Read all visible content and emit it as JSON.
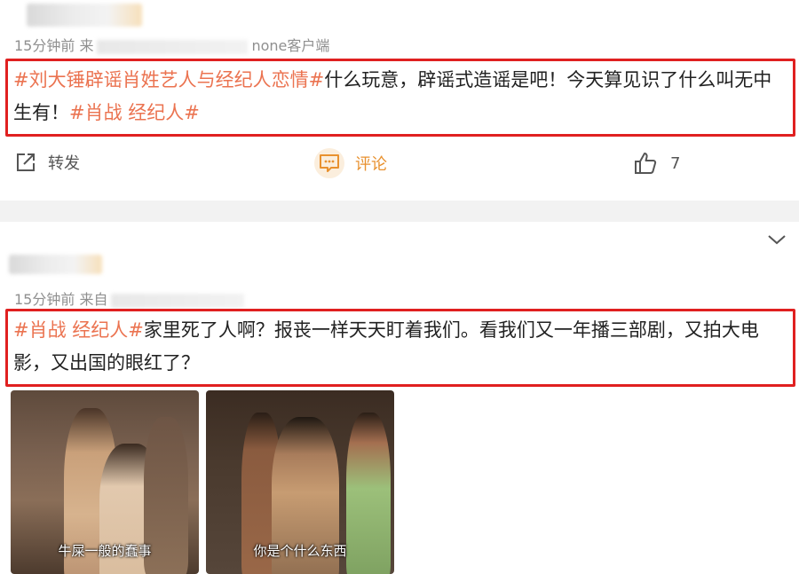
{
  "post1": {
    "meta_time": "15分钟前",
    "meta_source_prefix": "来",
    "meta_source_suffix": "none客户端",
    "content_tag": "#刘大锤辟谣肖姓艺人与经纪人恋情#",
    "content_text1": "什么玩意，辟谣式造谣是吧！今天算见识了什么叫无中生有！",
    "content_tag2": "#肖战 经纪人#",
    "actions": {
      "repost_label": "转发",
      "comment_label": "评论",
      "like_count": "7"
    }
  },
  "post2": {
    "meta_time": "15分钟前",
    "meta_source_prefix": "来自",
    "content_tag": "#肖战 经纪人#",
    "content_text": "家里死了人啊？报丧一样天天盯着我们。看我们又一年播三部剧，又拍大电影，又出国的眼红了？",
    "images": [
      {
        "caption": "牛屎一般的蠢事"
      },
      {
        "caption": "你是个什么东西"
      }
    ]
  },
  "colors": {
    "tag": "#eb7350",
    "highlight_border": "#e02020",
    "comment_accent": "#e8912f"
  },
  "icons": {
    "repost": "share-icon",
    "comment": "comment-icon",
    "like": "thumbs-up-icon",
    "menu": "chevron-down-icon"
  }
}
